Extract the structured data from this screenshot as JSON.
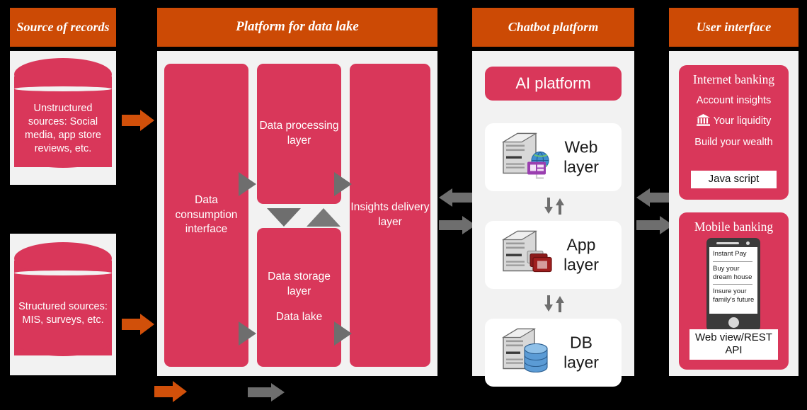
{
  "columns": {
    "source": {
      "header": "Source of records"
    },
    "platform": {
      "header": "Platform for data lake"
    },
    "chatbot": {
      "header": "Chatbot platform"
    },
    "ui": {
      "header": "User interface"
    }
  },
  "sources": {
    "unstructured": "Unstructured sources: Social media, app store reviews, etc.",
    "structured": "Structured sources: MIS, surveys, etc."
  },
  "platform": {
    "consumption": "Data consumption interface",
    "processing": "Data processing layer",
    "storage_layer": "Data storage layer",
    "storage_sub": "Data lake",
    "insights": "Insights delivery layer"
  },
  "chatbot": {
    "ai_platform": "AI platform",
    "layers": [
      {
        "label": "Web layer",
        "icon": "server-web-icon"
      },
      {
        "label": "App layer",
        "icon": "server-app-icon"
      },
      {
        "label": "DB layer",
        "icon": "server-db-icon"
      }
    ]
  },
  "ui": {
    "internet": {
      "title": "Internet banking",
      "items": [
        "Account insights",
        "Your liquidity",
        "Build your wealth"
      ],
      "chip": "Java script"
    },
    "mobile": {
      "title": "Mobile banking",
      "screen_items": [
        "Instant Pay",
        "Buy your dream house",
        "Insure your family's future"
      ],
      "chip": "Web view/REST API"
    }
  },
  "legend": {
    "orange_arrow": "data-ingestion-flow",
    "gray_arrow": "request-response-flow"
  },
  "colors": {
    "header_orange": "#CC4A05",
    "panel_gray": "#F2F2F2",
    "accent_pink": "#D9375A",
    "arrow_gray": "#6E6E6E",
    "arrow_orange": "#D1500A"
  }
}
